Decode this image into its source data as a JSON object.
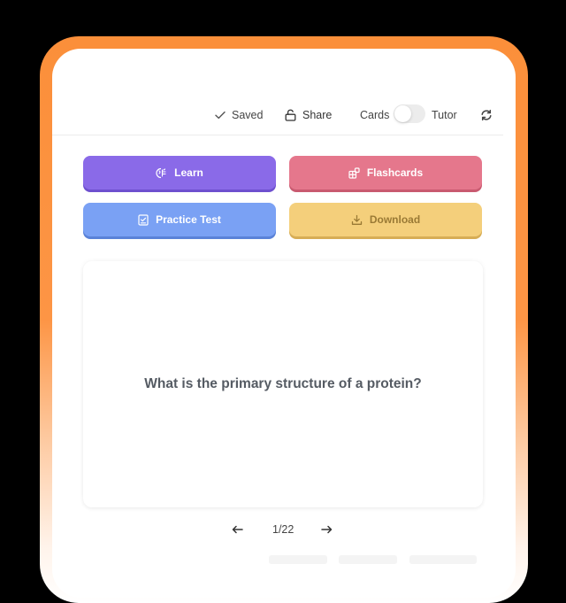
{
  "toolbar": {
    "saved_label": "Saved",
    "share_label": "Share",
    "mode_left_label": "Cards",
    "mode_right_label": "Tutor",
    "mode_toggle_on": false
  },
  "actions": {
    "learn_label": "Learn",
    "flashcards_label": "Flashcards",
    "practice_test_label": "Practice Test",
    "download_label": "Download"
  },
  "colors": {
    "frame_accent": "#fb8f3a",
    "learn": "#8a6ae8",
    "flashcards": "#e5778c",
    "practice_test": "#7aa1f4",
    "download": "#f4cf7b"
  },
  "flashcard": {
    "question": "What is the primary structure of a protein?"
  },
  "pager": {
    "counter": "1/22",
    "current": 1,
    "total": 22
  }
}
